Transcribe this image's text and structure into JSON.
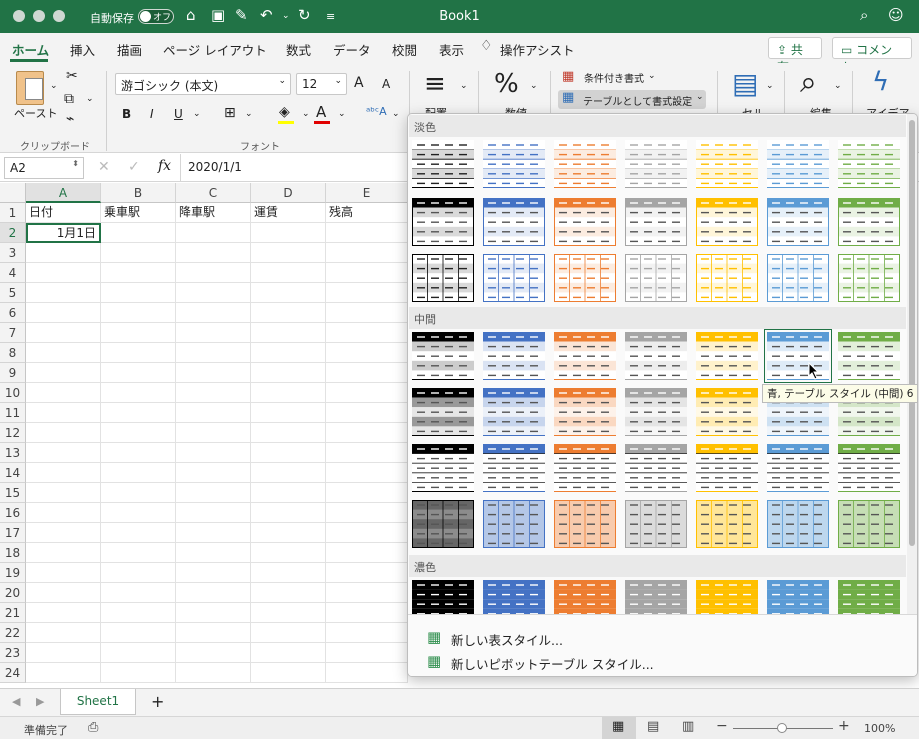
{
  "titlebar": {
    "autosave_label": "自動保存",
    "autosave_state": "オフ",
    "title": "Book1"
  },
  "tabs": [
    "ホーム",
    "挿入",
    "描画",
    "ページ レイアウト",
    "数式",
    "データ",
    "校閲",
    "表示",
    "操作アシスト"
  ],
  "header_buttons": {
    "share": "共有",
    "comment": "コメント"
  },
  "ribbon": {
    "paste": "ペースト",
    "clipboard_group": "クリップボード",
    "font_name": "游ゴシック (本文)",
    "font_size": "12",
    "font_group": "フォント",
    "bold": "B",
    "italic": "I",
    "underline": "U",
    "grow_font": "A",
    "shrink_font": "A",
    "cond_format": "条件付き書式",
    "table_format": "テーブルとして書式設定",
    "partial_labels": {
      "align": "配置",
      "number": "数値",
      "cells": "セル",
      "edit": "編集",
      "ideas": "アイデア"
    }
  },
  "formula_bar": {
    "name_box": "A2",
    "fx": "fx",
    "value": "2020/1/1"
  },
  "sheet": {
    "columns": [
      "A",
      "B",
      "C",
      "D",
      "E"
    ],
    "rows": [
      "1",
      "2",
      "3",
      "4",
      "5",
      "6",
      "7",
      "8",
      "9",
      "10",
      "11",
      "12",
      "13",
      "14",
      "15",
      "16",
      "17",
      "18",
      "19",
      "20",
      "21",
      "22",
      "23",
      "24"
    ],
    "row1": [
      "日付",
      "乗車駅",
      "降車駅",
      "運賃",
      "残高"
    ],
    "a2": "1月1日"
  },
  "gallery": {
    "sections": [
      "淡色",
      "中間",
      "濃色"
    ],
    "tooltip": "青, テーブル スタイル (中間) 6",
    "new_table_style": "新しい表スタイル...",
    "new_pivot_style": "新しいピボットテーブル スタイル...",
    "palette": [
      "#000000",
      "#4472c4",
      "#ed7d31",
      "#a5a5a5",
      "#ffc000",
      "#5b9bd5",
      "#70ad47"
    ]
  },
  "sheetbar": {
    "tab": "Sheet1",
    "add": "+"
  },
  "status": {
    "ready": "準備完了",
    "zoom": "100%"
  }
}
